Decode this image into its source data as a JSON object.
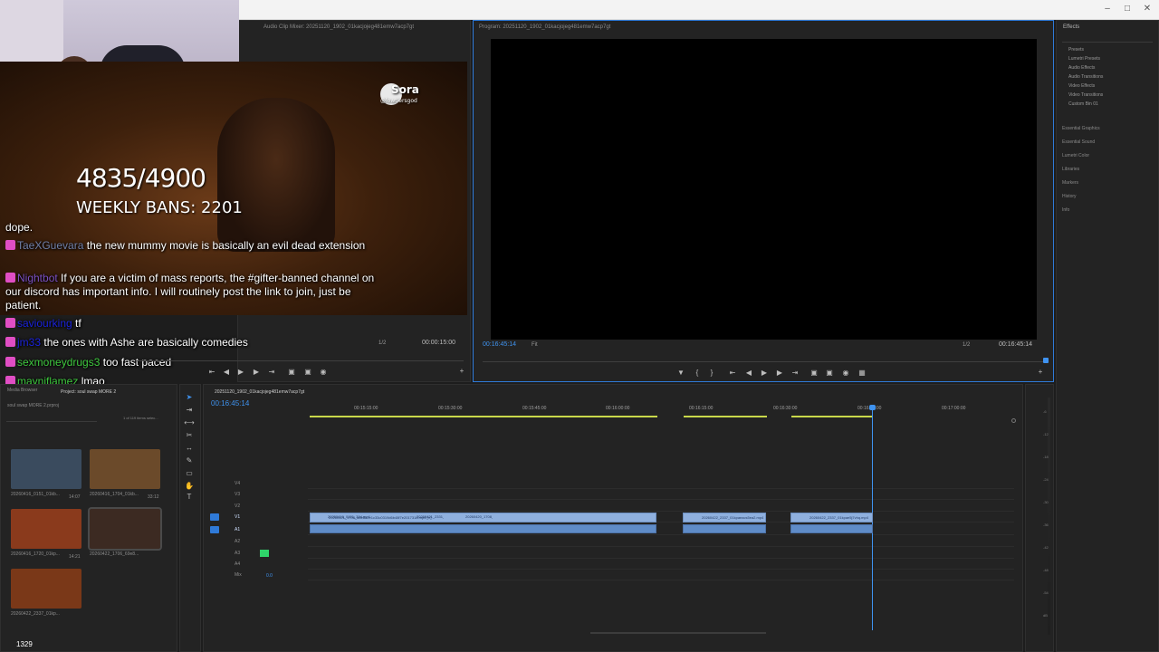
{
  "app": {
    "accent": "#2f7ad8",
    "playhead": "#3f93f0",
    "selection_green": "#2fd36a"
  },
  "panels": {
    "audio_mixer_title": "Audio Clip Mixer: 20251120_1902_01kacjojeg481emw7acp7gt",
    "program_title": "Program: 20251120_1902_01kacjojeg481emw7acp7gt",
    "effects_title": "Effects",
    "sequence_tab": "20251120_1902_01kacjojeg481emw7acp7gt",
    "media_browser_tab": "Media Browser",
    "project_tab": "Project: soul swap MORE 2",
    "project_file": "soul swap MORE 2.prproj",
    "items_selected": "1 of 119 items selec..."
  },
  "stream": {
    "bans_count": "4835/4900",
    "weekly_bans": "WEEKLY BANS: 2201",
    "sora_label": "Sora",
    "sora_handle": "@lowtiersgod",
    "viewer_count": "1329"
  },
  "chat": [
    {
      "user": "",
      "color": "#ffffff",
      "text": "dope."
    },
    {
      "user": "TaeXGuevara",
      "color": "#6f7fa8",
      "text": "the new mummy movie is basically an evil dead extension"
    },
    {
      "user": "Nightbot",
      "color": "#7a50c2",
      "text": "If you are a victim of mass reports, the #gifter-banned channel on our discord has important info. I will routinely post the link to join, just be patient."
    },
    {
      "user": "saviourking",
      "color": "#1a22d8",
      "text": "tf"
    },
    {
      "user": "jm33",
      "color": "#1a22d8",
      "text": "the ones with Ashe are basically comedies"
    },
    {
      "user": "sexmoneydrugs3",
      "color": "#3ec83e",
      "text": "too fast paced"
    },
    {
      "user": "mayniflamez",
      "color": "#3ec83e",
      "text": "lmao"
    }
  ],
  "source_monitor": {
    "zoom": "1/2",
    "timecode": "00:00:15:00"
  },
  "program_monitor": {
    "timecode_left": "00:16:45:14",
    "fit": "Fit",
    "zoom": "1/2",
    "timecode_right": "00:16:45:14"
  },
  "effects": {
    "tree": [
      "Presets",
      "Lumetri Presets",
      "Audio Effects",
      "Audio Transitions",
      "Video Effects",
      "Video Transitions",
      "Custom Bin 01"
    ],
    "sections": [
      "Essential Graphics",
      "Essential Sound",
      "Lumetri Color",
      "Libraries",
      "Markers",
      "History",
      "Info"
    ]
  },
  "timeline": {
    "timecode": "00:16:45:14",
    "ruler": [
      "00:15:15:00",
      "00:15:30:00",
      "00:15:45:00",
      "00:16:00:00",
      "00:16:15:00",
      "00:16:30:00",
      "00:16:45:00",
      "00:17:00:00"
    ],
    "tracks": [
      "V4",
      "V3",
      "V2",
      "V1",
      "A1",
      "A2",
      "A3",
      "A4",
      "Mix"
    ],
    "mix_value": "0.0",
    "clips": [
      "20260416_0151_39d.mp4",
      "20260421_2331_...",
      "20260420_1708_...",
      "20260421_1708_a8e8a2e1c33c0319d6b48f7e2017318.mp4 [V]",
      "20260422_2337_01kpaeacs5ea2.mp4",
      "20260422_2337_01kpae5j7vhq.mp4"
    ]
  },
  "project_bin": [
    {
      "name": "20260416_0151_01kb...",
      "dur": "14:21"
    },
    {
      "name": "20260416_1704_01kb...",
      "dur": "14:07"
    },
    {
      "name": "20260416_1720_01kp...",
      "dur": "14:07"
    },
    {
      "name": "20260422_1706_69e8...",
      "dur": "33:12"
    },
    {
      "name": "20260422_2337_01kp...",
      "dur": "14:21"
    },
    {
      "name": "20260422_1307_01kp...",
      "dur": "14:21"
    },
    {
      "name": "20260422_2257_01kp...",
      "dur": "15:00"
    }
  ],
  "meter_scale": [
    "-6",
    "-12",
    "-18",
    "-24",
    "-30",
    "-36",
    "-42",
    "-48",
    "-54",
    "dB"
  ]
}
